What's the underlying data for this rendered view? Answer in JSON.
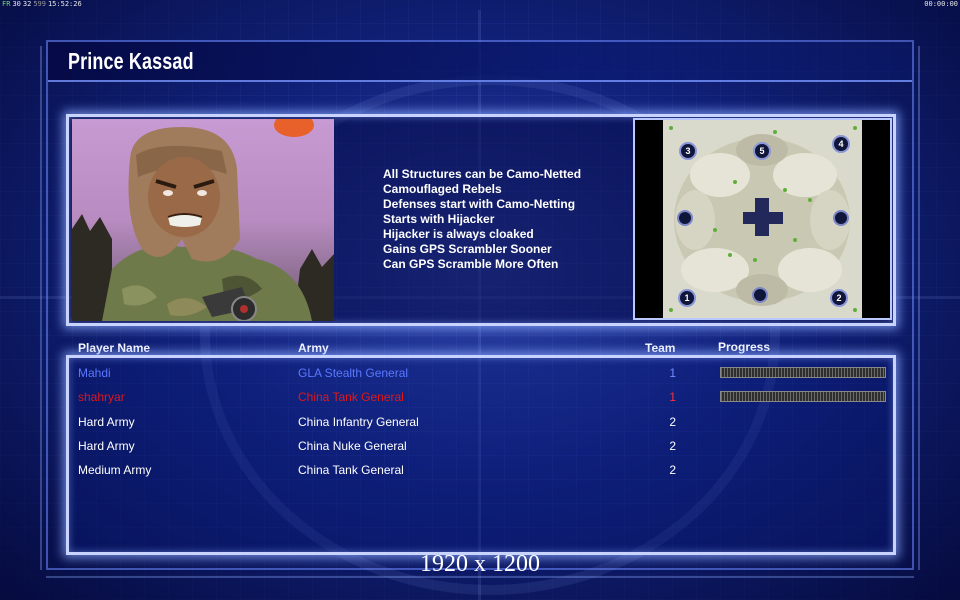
{
  "overlay": {
    "fps_prefix": "FR",
    "fps_value": "30",
    "fps_extra": "32",
    "fps_dim": "599",
    "clock_left": "15:52:26",
    "clock_right": "00:00:00"
  },
  "general": {
    "name": "Prince Kassad",
    "features": [
      "All Structures can be Camo-Netted",
      "Camouflaged Rebels",
      "Defenses start with Camo-Netting",
      "Starts with Hijacker",
      "Hijacker is always cloaked",
      "Gains GPS Scrambler Sooner",
      "Can GPS Scramble More Often"
    ]
  },
  "map": {
    "start_markers": [
      "1",
      "2",
      "3",
      "4",
      "5"
    ]
  },
  "table": {
    "headers": {
      "player": "Player Name",
      "army": "Army",
      "team": "Team",
      "progress": "Progress"
    },
    "rows": [
      {
        "player": "Mahdi",
        "army": "GLA Stealth General",
        "team": "1",
        "color": "#5a78ff",
        "team_color": "#6f8cff",
        "progress": 1.0
      },
      {
        "player": "shahryar",
        "army": "China Tank General",
        "team": "1",
        "color": "#e01818",
        "team_color": "#ff3030",
        "progress": 1.0
      },
      {
        "player": "Hard Army",
        "army": "China Infantry General",
        "team": "2",
        "color": "#ffffff",
        "team_color": "#ffffff"
      },
      {
        "player": "Hard Army",
        "army": "China Nuke General",
        "team": "2",
        "color": "#ffffff",
        "team_color": "#ffffff"
      },
      {
        "player": "Medium Army",
        "army": "China Tank General",
        "team": "2",
        "color": "#ffffff",
        "team_color": "#ffffff"
      }
    ]
  },
  "resolution_label": "1920 x 1200",
  "colors": {
    "panel_glow": "#c8d4ff",
    "background": "#0d1a66",
    "human_player_blue": "#5a78ff",
    "human_player_red": "#e01818"
  }
}
